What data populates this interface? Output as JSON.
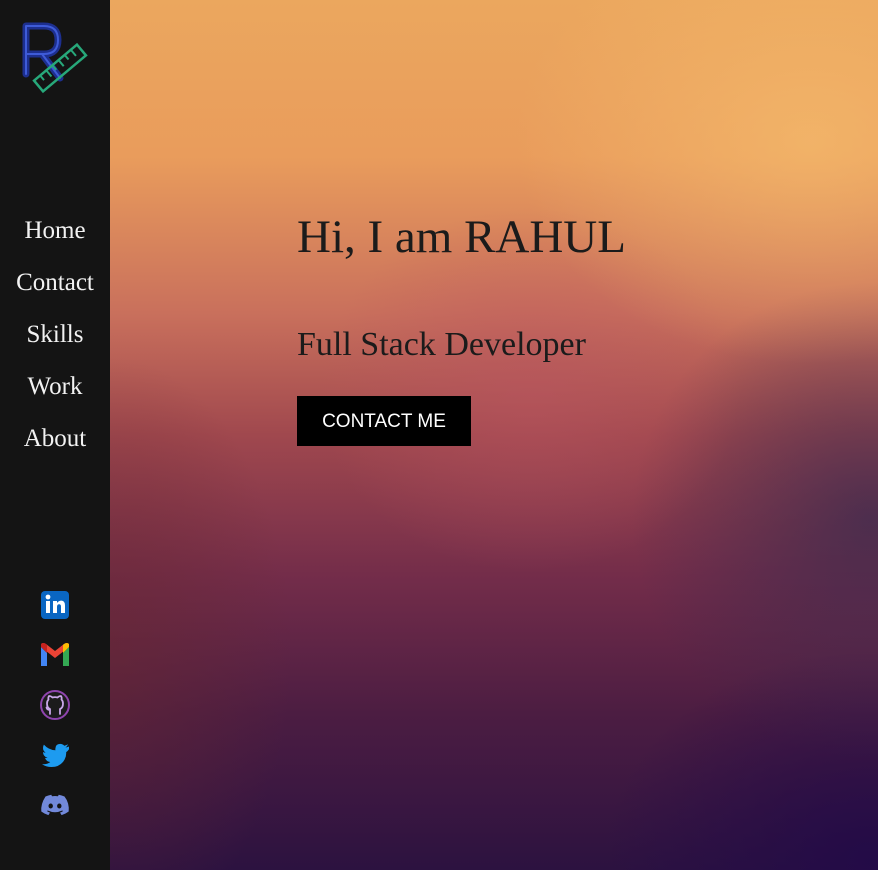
{
  "sidebar": {
    "nav": [
      {
        "label": "Home"
      },
      {
        "label": "Contact"
      },
      {
        "label": "Skills"
      },
      {
        "label": "Work"
      },
      {
        "label": "About"
      }
    ],
    "socials": [
      {
        "icon": "linkedin-icon",
        "color": "#0a66c2"
      },
      {
        "icon": "gmail-icon",
        "color": "#ea4335"
      },
      {
        "icon": "github-icon",
        "color": "#8e44ad"
      },
      {
        "icon": "twitter-icon",
        "color": "#1d9bf0"
      },
      {
        "icon": "discord-icon",
        "color": "#7289da"
      }
    ]
  },
  "hero": {
    "title": "Hi, I am RAHUL",
    "subtitle": "Full Stack Developer",
    "cta_label": "CONTACT ME"
  },
  "colors": {
    "sidebar_bg": "#141414",
    "text_dark": "#1b1b1b",
    "cta_bg": "#000000"
  }
}
